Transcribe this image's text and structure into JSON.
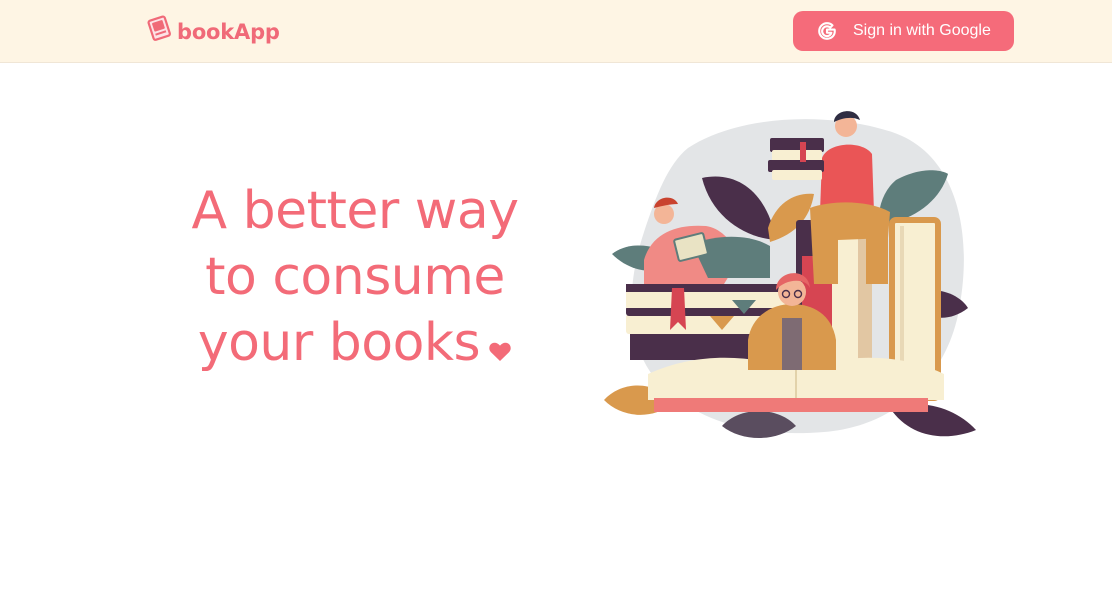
{
  "header": {
    "brand_name": "bookApp",
    "brand_icon": "book-icon",
    "signin_label": "Sign in with Google",
    "signin_icon": "google-icon"
  },
  "hero": {
    "lines": [
      "A better way",
      "to consume",
      "your books"
    ],
    "heart_icon": "heart-icon"
  },
  "illustration": {
    "name": "people-reading-books-illustration"
  },
  "colors": {
    "accent": "#f56b7a",
    "heading": "#f36b78",
    "header_bg": "#fef5e4",
    "page_bg": "#ffffff"
  }
}
